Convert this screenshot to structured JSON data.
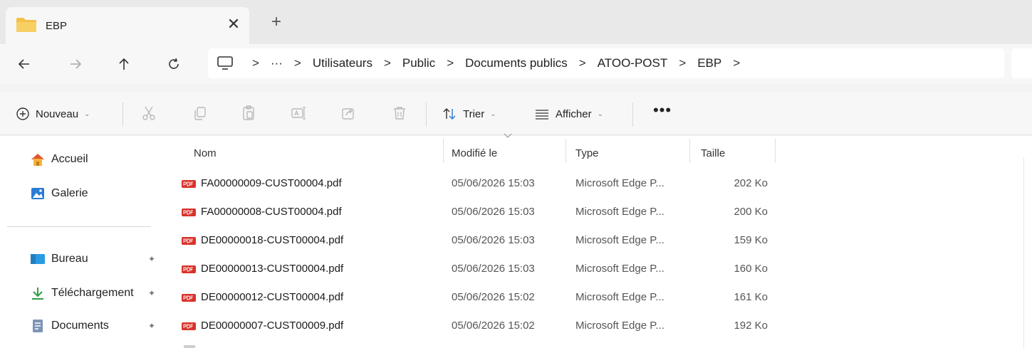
{
  "tab": {
    "title": "EBP",
    "close_glyph": "✕",
    "new_glyph": "+"
  },
  "nav": {
    "back": "arrow-left-icon",
    "forward": "arrow-right-icon",
    "up": "arrow-up-icon",
    "refresh": "refresh-icon"
  },
  "address": {
    "overflow": "···",
    "separator": ">",
    "crumbs": [
      "Utilisateurs",
      "Public",
      "Documents publics",
      "ATOO-POST",
      "EBP"
    ]
  },
  "toolbar": {
    "new_label": "Nouveau",
    "sort_label": "Trier",
    "view_label": "Afficher",
    "more_glyph": "•••"
  },
  "sidebar": {
    "items": [
      {
        "label": "Accueil",
        "icon": "home-icon",
        "pinned": false
      },
      {
        "label": "Galerie",
        "icon": "gallery-icon",
        "pinned": false
      },
      {
        "label": "Bureau",
        "icon": "desktop-icon",
        "pinned": true
      },
      {
        "label": "Téléchargement",
        "icon": "download-icon",
        "pinned": true
      },
      {
        "label": "Documents",
        "icon": "documents-icon",
        "pinned": true
      }
    ],
    "pin_glyph": "📌"
  },
  "columns": {
    "name": "Nom",
    "modified": "Modifié le",
    "type": "Type",
    "size": "Taille"
  },
  "files": [
    {
      "name": "FA00000009-CUST00004.pdf",
      "modified": "05/06/2026 15:03",
      "type": "Microsoft Edge P...",
      "size": "202 Ko"
    },
    {
      "name": "FA00000008-CUST00004.pdf",
      "modified": "05/06/2026 15:03",
      "type": "Microsoft Edge P...",
      "size": "200 Ko"
    },
    {
      "name": "DE00000018-CUST00004.pdf",
      "modified": "05/06/2026 15:03",
      "type": "Microsoft Edge P...",
      "size": "159 Ko"
    },
    {
      "name": "DE00000013-CUST00004.pdf",
      "modified": "05/06/2026 15:03",
      "type": "Microsoft Edge P...",
      "size": "160 Ko"
    },
    {
      "name": "DE00000012-CUST00004.pdf",
      "modified": "05/06/2026 15:02",
      "type": "Microsoft Edge P...",
      "size": "161 Ko"
    },
    {
      "name": "DE00000007-CUST00009.pdf",
      "modified": "05/06/2026 15:02",
      "type": "Microsoft Edge P...",
      "size": "192 Ko"
    }
  ],
  "colors": {
    "folder": "#f4c04a",
    "pdf_badge": "#d9322a",
    "accent_blue": "#2b7cd3",
    "download_green": "#2f9e44"
  }
}
